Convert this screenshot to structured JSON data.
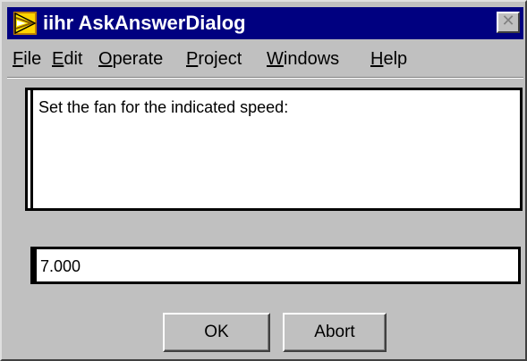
{
  "window": {
    "title": "iihr AskAnswerDialog",
    "app_icon": "labview-run-arrow-icon",
    "close_glyph": "✕"
  },
  "menu": {
    "items": [
      {
        "mnemonic": "F",
        "rest": "ile"
      },
      {
        "mnemonic": "E",
        "rest": "dit"
      },
      {
        "mnemonic": "O",
        "rest": "perate"
      },
      {
        "mnemonic": "P",
        "rest": "roject"
      },
      {
        "mnemonic": "W",
        "rest": "indows"
      },
      {
        "mnemonic": "H",
        "rest": "elp"
      }
    ]
  },
  "dialog": {
    "message": "Set the fan for the indicated speed:",
    "value": "7.000"
  },
  "buttons": {
    "ok_label": "OK",
    "abort_label": "Abort"
  },
  "colors": {
    "titlebar": "#000080",
    "face": "#c0c0c0",
    "field_bg": "#ffffff"
  }
}
